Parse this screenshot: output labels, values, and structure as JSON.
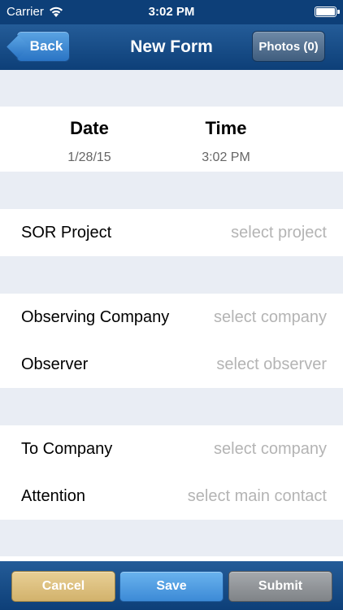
{
  "status_bar": {
    "carrier": "Carrier",
    "time": "3:02 PM"
  },
  "nav": {
    "back_label": "Back",
    "title": "New Form",
    "photos_label": "Photos (0)"
  },
  "datetime": {
    "date_label": "Date",
    "date_value": "1/28/15",
    "time_label": "Time",
    "time_value": "3:02 PM"
  },
  "project": {
    "label": "SOR Project",
    "placeholder": "select project"
  },
  "observing": {
    "company_label": "Observing Company",
    "company_placeholder": "select company",
    "observer_label": "Observer",
    "observer_placeholder": "select observer"
  },
  "recipient": {
    "company_label": "To Company",
    "company_placeholder": "select company",
    "attention_label": "Attention",
    "attention_placeholder": "select main contact"
  },
  "toolbar": {
    "cancel_label": "Cancel",
    "save_label": "Save",
    "submit_label": "Submit"
  },
  "colors": {
    "nav_bar": "#0d3f78",
    "back_button": "#3d8ad6",
    "cancel_button": "#dcc080",
    "save_button": "#4f9ce2",
    "submit_button": "#8f9397",
    "background": "#e9edf4"
  }
}
